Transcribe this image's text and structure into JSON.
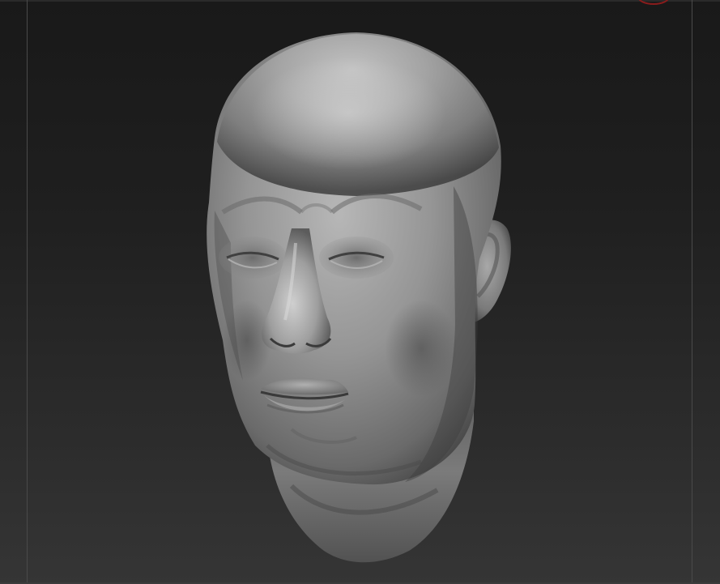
{
  "app": {
    "background_top": "#191919",
    "background_bottom": "#353535",
    "frame_line_color": "#4a4a4a",
    "indicator_color": "#8a1c1c"
  },
  "viewport": {
    "model": "sculpted-head",
    "material_base": "#8a8a8a",
    "material_highlight": "#cfcfcf",
    "material_shadow": "#3a3a3a"
  }
}
